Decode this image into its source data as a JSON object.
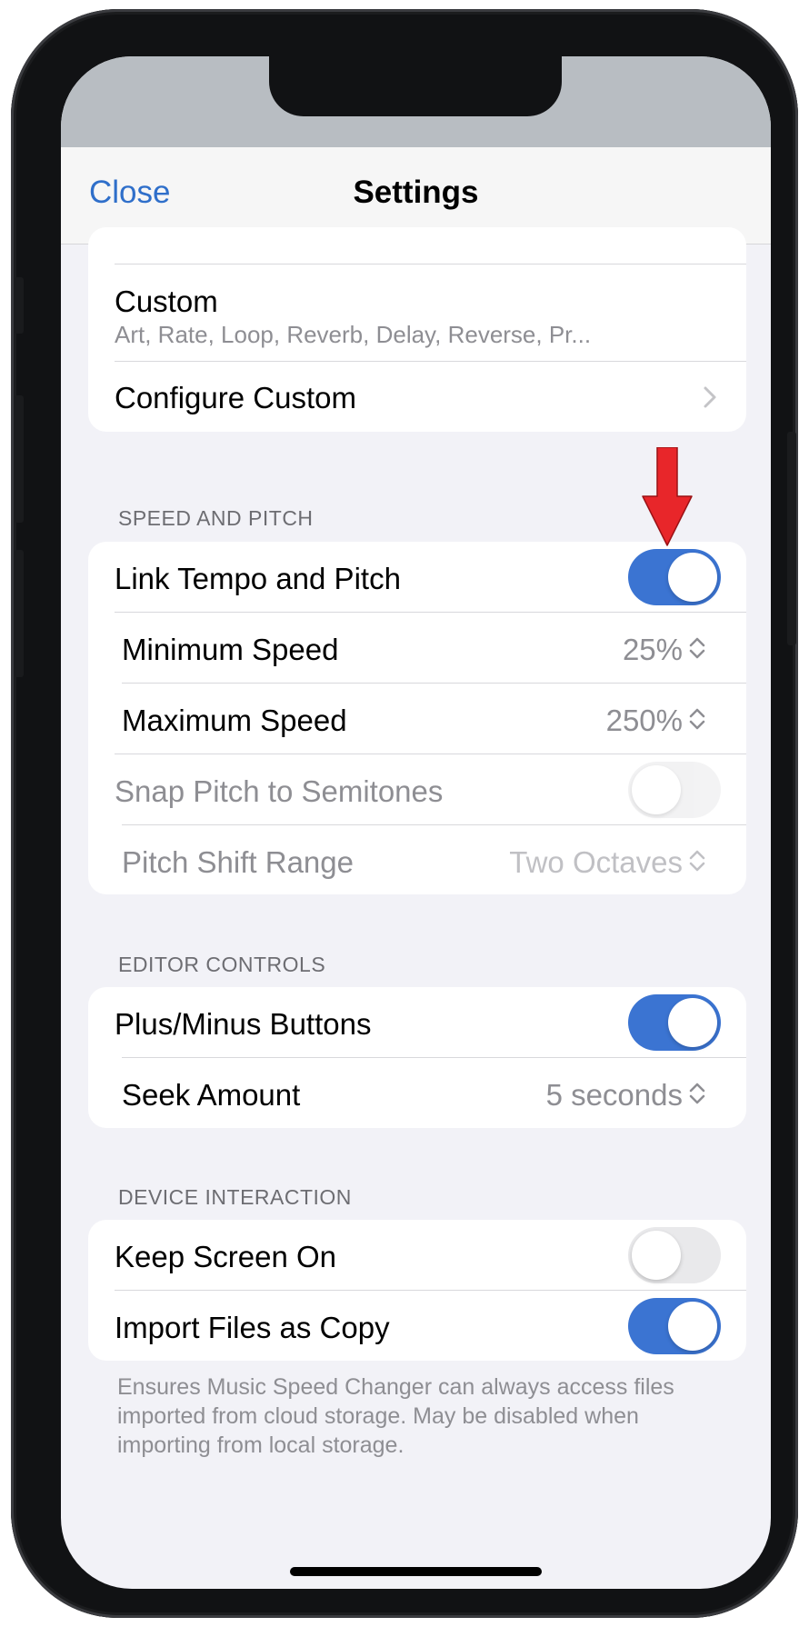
{
  "nav": {
    "close_label": "Close",
    "title": "Settings"
  },
  "group_top": {
    "custom_title": "Custom",
    "custom_subtitle": "Art, Rate, Loop, Reverb, Delay, Reverse, Pr...",
    "configure_label": "Configure Custom"
  },
  "speed_pitch": {
    "header": "SPEED AND PITCH",
    "link_tempo_label": "Link Tempo and Pitch",
    "link_tempo_on": true,
    "min_speed_label": "Minimum Speed",
    "min_speed_value": "25%",
    "max_speed_label": "Maximum Speed",
    "max_speed_value": "250%",
    "snap_pitch_label": "Snap Pitch to Semitones",
    "snap_pitch_on": false,
    "pitch_range_label": "Pitch Shift Range",
    "pitch_range_value": "Two Octaves"
  },
  "editor_controls": {
    "header": "EDITOR CONTROLS",
    "plus_minus_label": "Plus/Minus Buttons",
    "plus_minus_on": true,
    "seek_amount_label": "Seek Amount",
    "seek_amount_value": "5 seconds"
  },
  "device_interaction": {
    "header": "DEVICE INTERACTION",
    "keep_screen_label": "Keep Screen On",
    "keep_screen_on": false,
    "import_copy_label": "Import Files as Copy",
    "import_copy_on": true,
    "footer": "Ensures Music Speed Changer can always access files imported from cloud storage. May be disabled when importing from local storage."
  },
  "colors": {
    "accent": "#3b74d2",
    "link": "#2f6fca",
    "arrow": "#e8262a"
  }
}
